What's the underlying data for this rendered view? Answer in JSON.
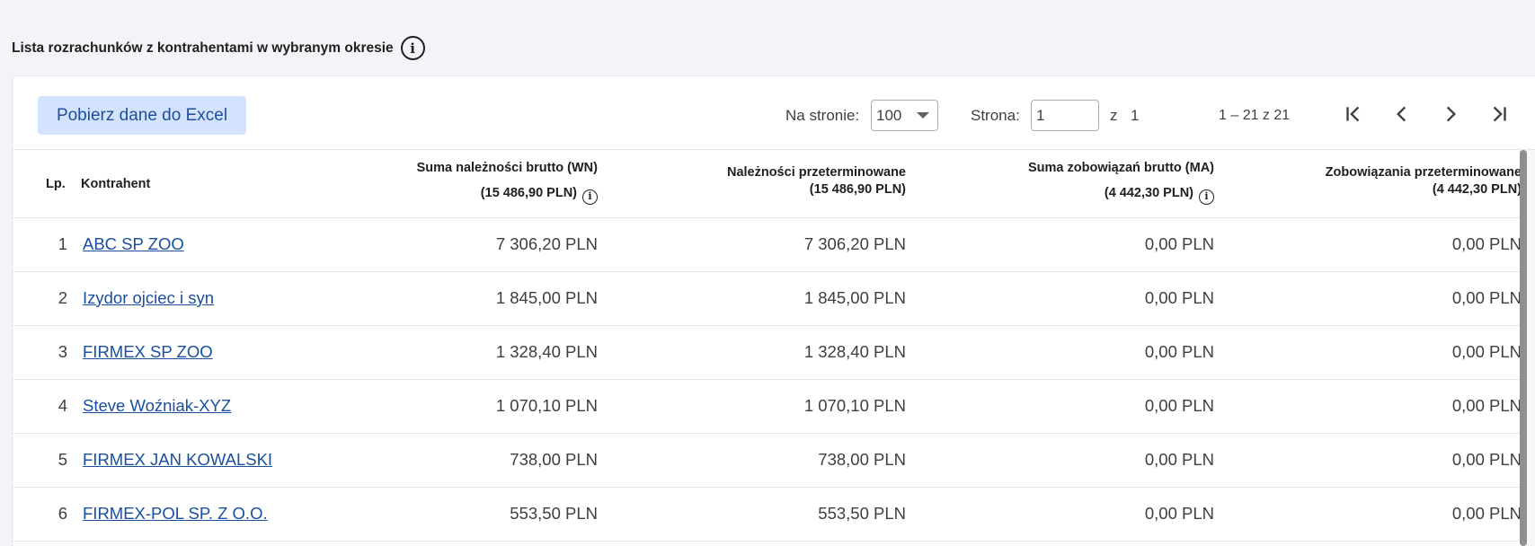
{
  "section": {
    "title": "Lista rozrachunków z kontrahentami w wybranym okresie",
    "info_icon": "info-icon"
  },
  "toolbar": {
    "excel_button": "Pobierz dane do Excel",
    "per_page_label": "Na stronie:",
    "per_page_value": "100",
    "page_label": "Strona:",
    "page_value": "1",
    "of_label": "z",
    "total_pages": "1",
    "range_text": "1 – 21 z 21",
    "nav_icons": [
      "first-page-icon",
      "prev-page-icon",
      "next-page-icon",
      "last-page-icon"
    ]
  },
  "table": {
    "headers": {
      "lp": "Lp.",
      "kontrahent": "Kontrahent",
      "wn_title": "Suma należności brutto (WN)",
      "wn_total": "(15 486,90 PLN)",
      "overdue_title": "Należności przeterminowane",
      "overdue_total": "(15 486,90 PLN)",
      "ma_title": "Suma zobowiązań brutto (MA)",
      "ma_total": "(4 442,30 PLN)",
      "ma_overdue_title": "Zobowiązania przeterminowane",
      "ma_overdue_total": "(4 442,30 PLN)"
    },
    "rows": [
      {
        "lp": "1",
        "name": "ABC SP ZOO",
        "wn": "7 306,20 PLN",
        "overdue": "7 306,20 PLN",
        "ma": "0,00 PLN",
        "ma_overdue": "0,00 PLN"
      },
      {
        "lp": "2",
        "name": "Izydor ojciec i syn",
        "wn": "1 845,00 PLN",
        "overdue": "1 845,00 PLN",
        "ma": "0,00 PLN",
        "ma_overdue": "0,00 PLN"
      },
      {
        "lp": "3",
        "name": "FIRMEX SP ZOO",
        "wn": "1 328,40 PLN",
        "overdue": "1 328,40 PLN",
        "ma": "0,00 PLN",
        "ma_overdue": "0,00 PLN"
      },
      {
        "lp": "4",
        "name": "Steve Woźniak-XYZ",
        "wn": "1 070,10 PLN",
        "overdue": "1 070,10 PLN",
        "ma": "0,00 PLN",
        "ma_overdue": "0,00 PLN"
      },
      {
        "lp": "5",
        "name": "FIRMEX JAN KOWALSKI",
        "wn": "738,00 PLN",
        "overdue": "738,00 PLN",
        "ma": "0,00 PLN",
        "ma_overdue": "0,00 PLN"
      },
      {
        "lp": "6",
        "name": "FIRMEX-POL SP. Z O.O.",
        "wn": "553,50 PLN",
        "overdue": "553,50 PLN",
        "ma": "0,00 PLN",
        "ma_overdue": "0,00 PLN"
      }
    ]
  }
}
